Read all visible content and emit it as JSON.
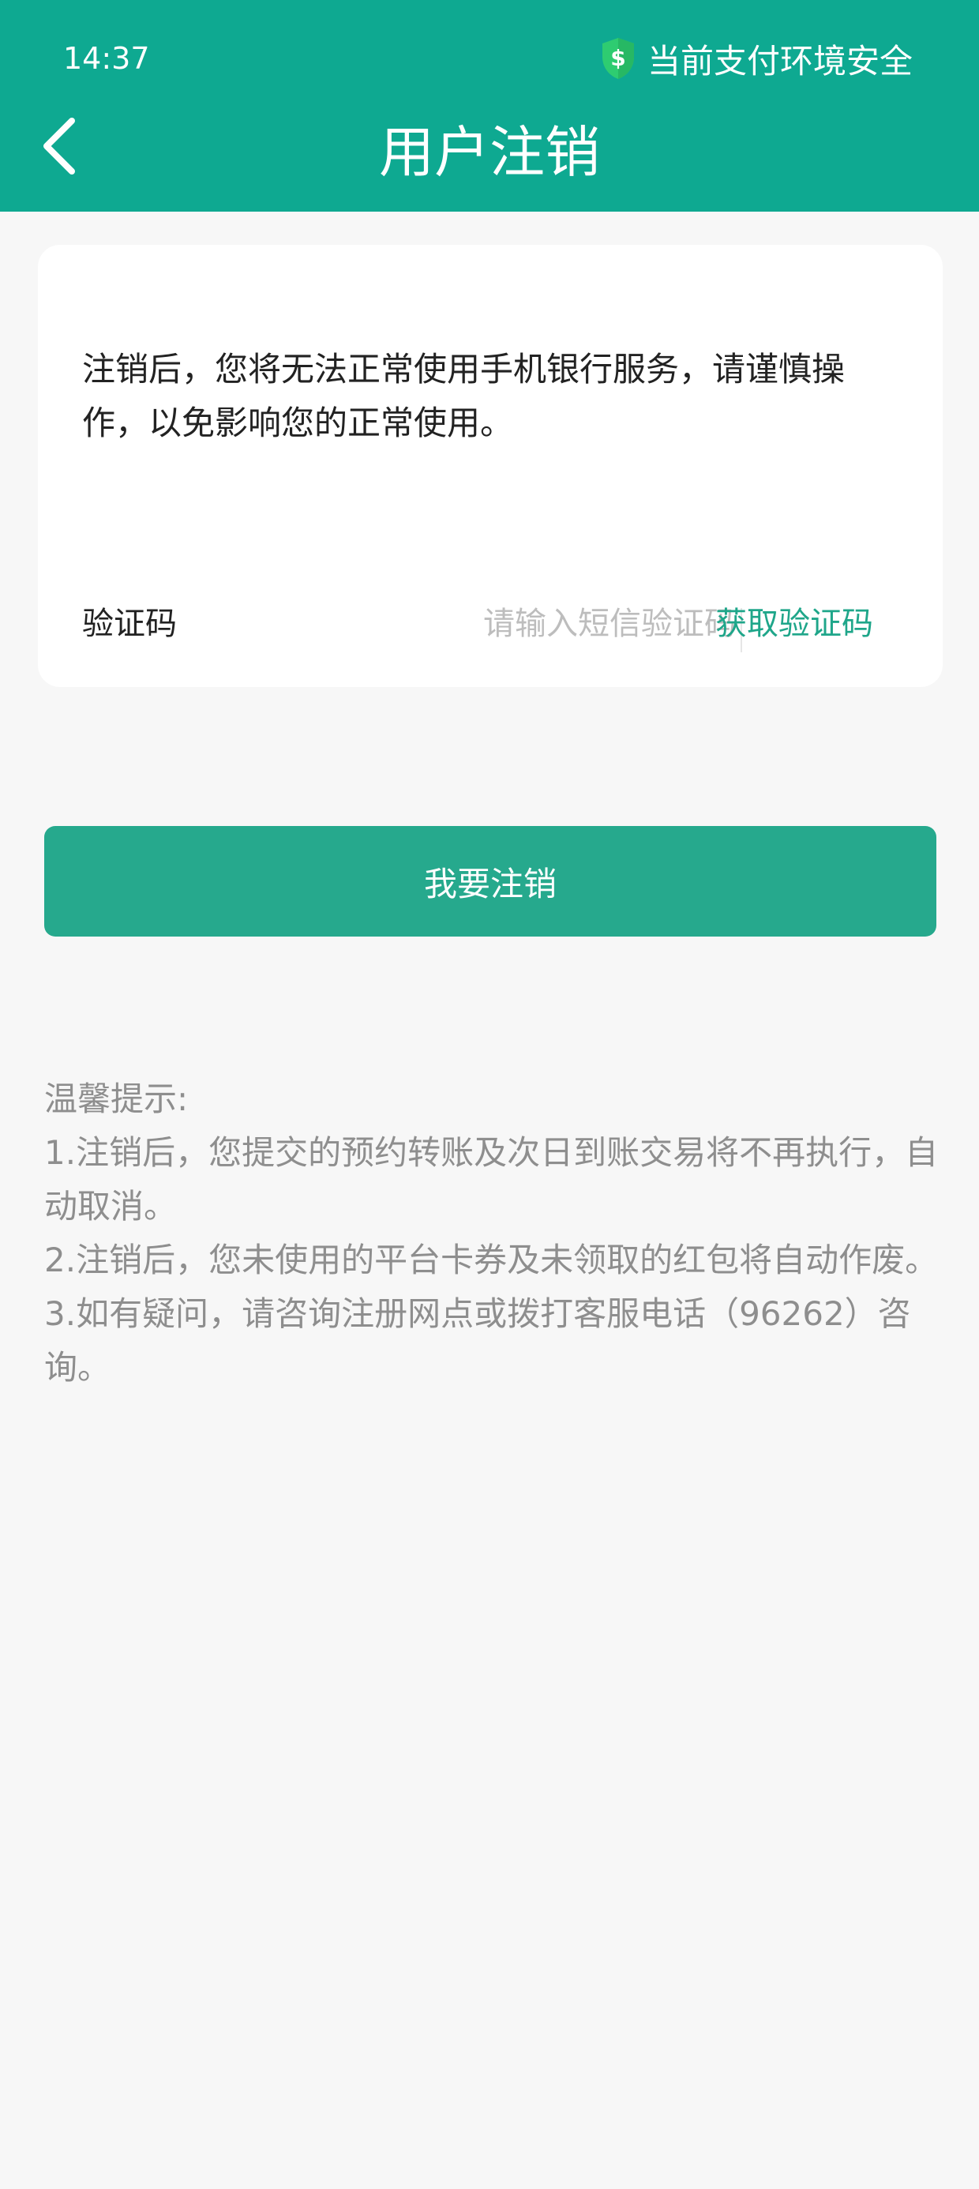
{
  "status_bar": {
    "time": "14:37",
    "security_text": "当前支付环境安全",
    "security_icon": "shield-dollar-icon"
  },
  "header": {
    "title": "用户注销",
    "back_icon": "chevron-left-icon"
  },
  "card": {
    "warning": "注销后，您将无法正常使用手机银行服务，请谨慎操作，以免影响您的正常使用。",
    "code_label": "验证码",
    "code_placeholder": "请输入短信验证码",
    "code_value": "",
    "get_code_label": "获取验证码"
  },
  "primary_action": {
    "label": "我要注销"
  },
  "tips": {
    "title": "温馨提示:",
    "items": [
      "1.注销后，您提交的预约转账及次日到账交易将不再执行，自动取消。",
      "2.注销后，您未使用的平台卡券及未领取的红包将自动作废。",
      "3.如有疑问，请咨询注册网点或拨打客服电话（96262）咨询。"
    ]
  },
  "colors": {
    "header_bg": "#0ea991",
    "button_bg": "#26a98d",
    "accent_text": "#1fa68a",
    "tips_text": "#8e8e8e",
    "page_bg": "#f7f7f7",
    "shield_green": "#2ecc71"
  }
}
